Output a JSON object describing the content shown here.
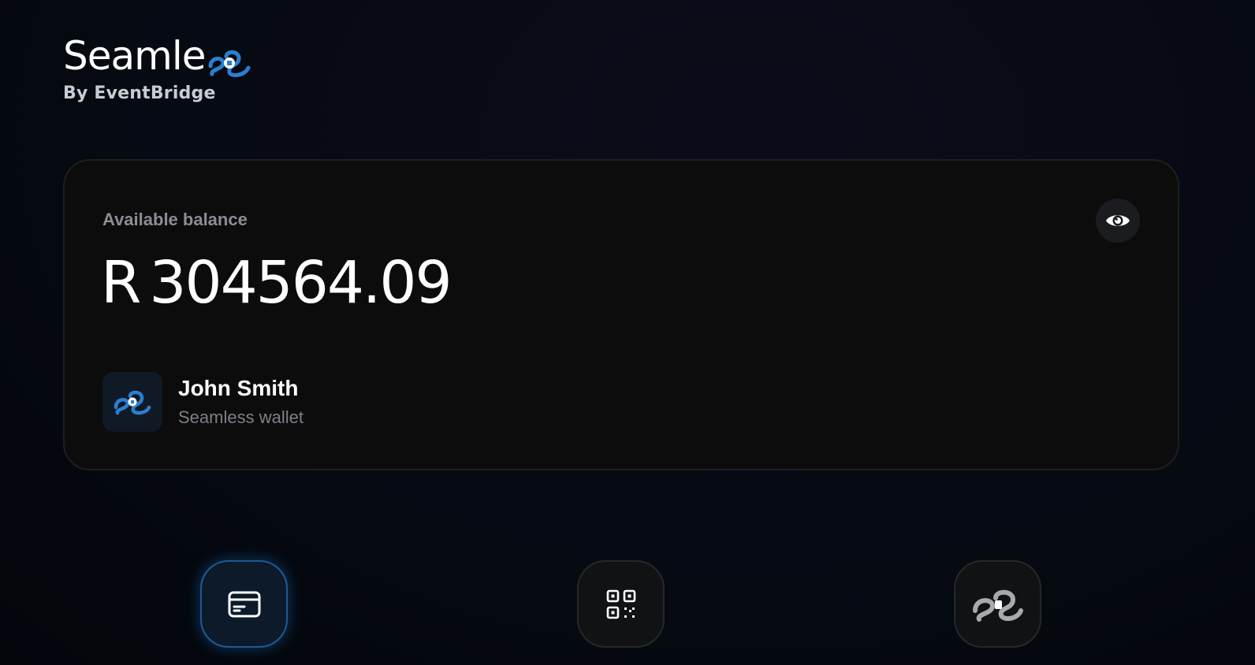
{
  "brand": {
    "name": "Seamle",
    "subtitle": "By EventBridge",
    "logo_icon": "seamless-ss-icon",
    "accent_color": "#2a7fd0"
  },
  "balance_card": {
    "label": "Available balance",
    "currency": "R",
    "amount": "304564.09",
    "visibility_icon": "eye-icon",
    "wallet": {
      "name": "John Smith",
      "type": "Seamless wallet",
      "icon": "seamless-ss-icon"
    }
  },
  "actions": [
    {
      "icon": "credit-card-icon",
      "active": true
    },
    {
      "icon": "qr-code-icon",
      "active": false
    },
    {
      "icon": "seamless-link-icon",
      "active": false
    }
  ]
}
